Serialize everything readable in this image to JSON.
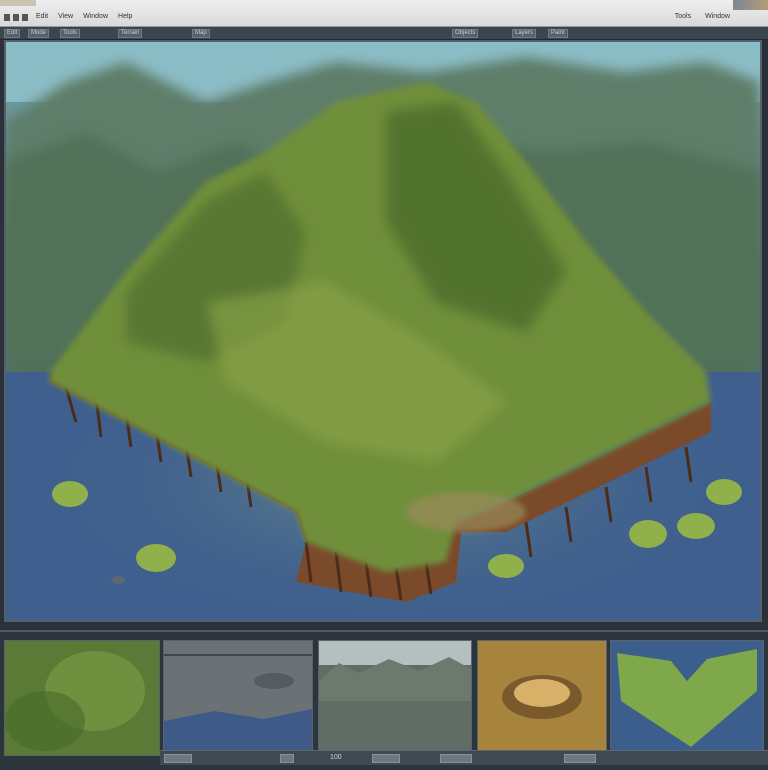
{
  "menubar": {
    "app_stamp": "",
    "left_items": [
      "Edit",
      "View",
      "Window",
      "Help"
    ],
    "right_items": [
      "Tools",
      "Window"
    ],
    "corner_label": ""
  },
  "toolbar": {
    "buttons": [
      "Edit",
      "Mode",
      "Tools",
      "Terrain",
      "Objects",
      "Layers",
      "Paint"
    ],
    "center_label": "Map"
  },
  "viewport": {
    "label": "Isometric island map view"
  },
  "thumbnails": [
    {
      "name": "grass-texture"
    },
    {
      "name": "rock-texture"
    },
    {
      "name": "forest-texture"
    },
    {
      "name": "sand-crater-texture"
    },
    {
      "name": "island-heart-texture"
    }
  ],
  "statusbar": {
    "items": [
      "",
      "",
      "",
      "",
      ""
    ],
    "zoom": "100"
  },
  "colors": {
    "menubar": "#e3e3e3",
    "toolbar": "#3b4550",
    "water": "#3d5e8c",
    "grass": "#6f8f3a",
    "cliff": "#7a4a2a"
  }
}
